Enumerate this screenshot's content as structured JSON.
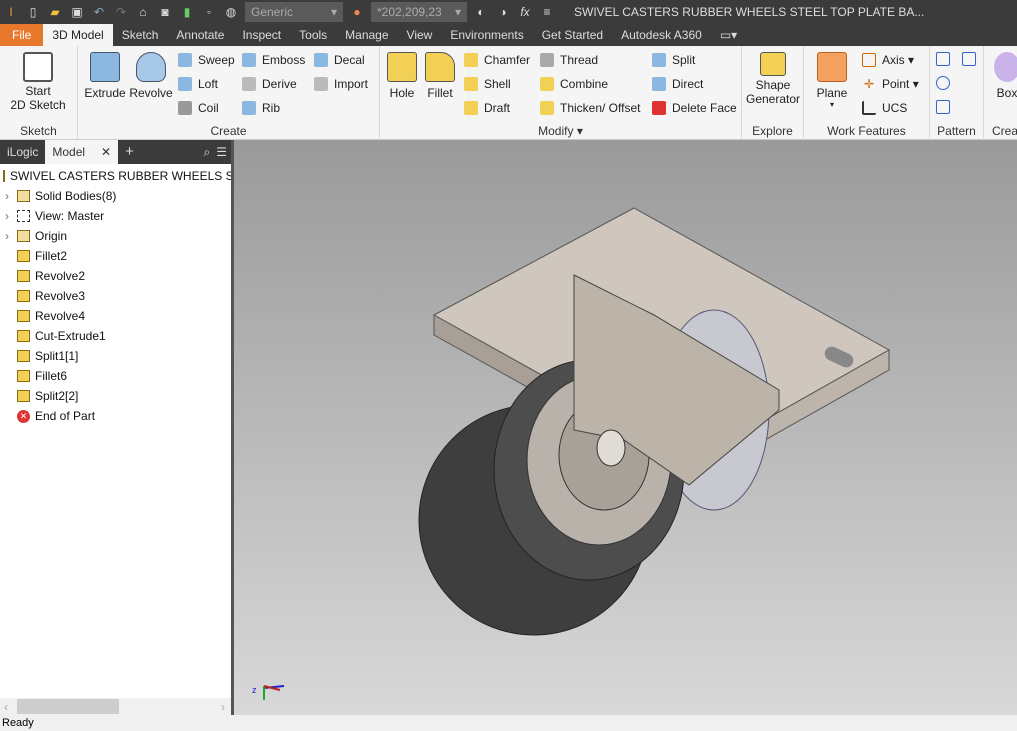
{
  "titlebar": {
    "style_combo": "Generic",
    "color_combo": "*202,209,23",
    "title": "SWIVEL CASTERS RUBBER WHEELS STEEL TOP PLATE BA..."
  },
  "tabs": [
    "File",
    "3D Model",
    "Sketch",
    "Annotate",
    "Inspect",
    "Tools",
    "Manage",
    "View",
    "Environments",
    "Get Started",
    "Autodesk A360"
  ],
  "ribbon": {
    "sketch": {
      "label": "Sketch",
      "start": "Start",
      "start2": "2D Sketch"
    },
    "create": {
      "label": "Create",
      "extrude": "Extrude",
      "revolve": "Revolve",
      "sweep": "Sweep",
      "loft": "Loft",
      "coil": "Coil",
      "emboss": "Emboss",
      "derive": "Derive",
      "rib": "Rib",
      "decal": "Decal",
      "import": "Import"
    },
    "modify": {
      "label": "Modify",
      "hole": "Hole",
      "fillet": "Fillet",
      "chamfer": "Chamfer",
      "shell": "Shell",
      "draft": "Draft",
      "thread": "Thread",
      "combine": "Combine",
      "thicken": "Thicken/ Offset",
      "split": "Split",
      "direct": "Direct",
      "delete_face": "Delete Face"
    },
    "explore": {
      "label": "Explore",
      "shape": "Shape",
      "generator": "Generator"
    },
    "work": {
      "label": "Work Features",
      "plane": "Plane",
      "axis": "Axis",
      "point": "Point",
      "ucs": "UCS"
    },
    "pattern": {
      "label": "Pattern"
    },
    "cre": {
      "label": "Crea",
      "box": "Box"
    }
  },
  "browser": {
    "tabs": [
      "iLogic",
      "Model"
    ],
    "root": "SWIVEL CASTERS RUBBER WHEELS STEEL T",
    "nodes": [
      "Solid Bodies(8)",
      "View: Master",
      "Origin",
      "Fillet2",
      "Revolve2",
      "Revolve3",
      "Revolve4",
      "Cut-Extrude1",
      "Split1[1]",
      "Fillet6",
      "Split2[2]",
      "End of Part"
    ]
  },
  "status": "Ready"
}
